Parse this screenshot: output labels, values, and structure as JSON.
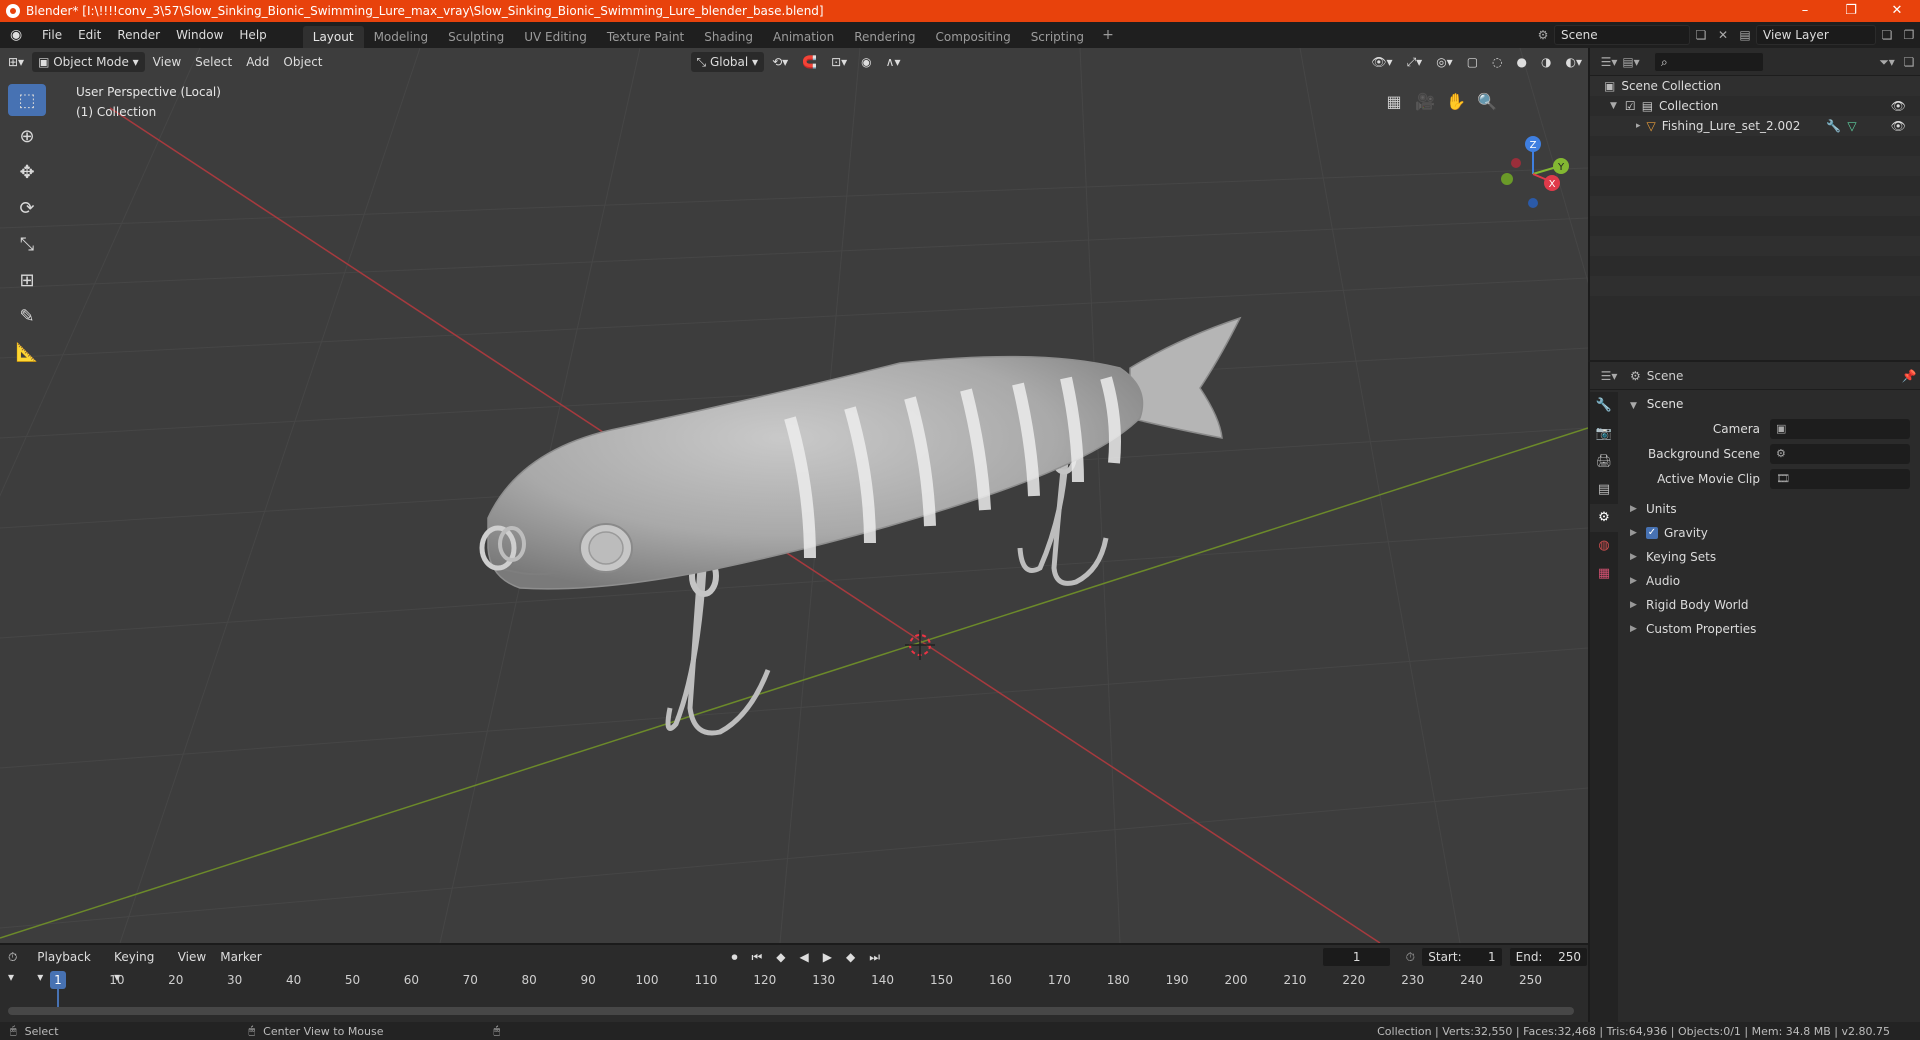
{
  "window": {
    "title": "Blender* [I:\\!!!!conv_3\\57\\Slow_Sinking_Bionic_Swimming_Lure_max_vray\\Slow_Sinking_Bionic_Swimming_Lure_blender_base.blend]",
    "min": "–",
    "max": "❐",
    "close": "✕"
  },
  "menu": [
    "File",
    "Edit",
    "Render",
    "Window",
    "Help"
  ],
  "workspaces": [
    "Layout",
    "Modeling",
    "Sculpting",
    "UV Editing",
    "Texture Paint",
    "Shading",
    "Animation",
    "Rendering",
    "Compositing",
    "Scripting"
  ],
  "workspace_add": "+",
  "scene_field": "Scene",
  "view_layer_field": "View Layer",
  "viewport": {
    "mode": "Object Mode",
    "menus": [
      "View",
      "Select",
      "Add",
      "Object"
    ],
    "orientation": "Global",
    "info_line1": "User Perspective (Local)",
    "info_line2": "(1) Collection",
    "gizmo": {
      "x": "X",
      "y": "Y",
      "z": "Z"
    }
  },
  "outliner": {
    "rows": [
      "Scene Collection",
      "Collection",
      "Fishing_Lure_set_2.002"
    ]
  },
  "properties": {
    "header": "Scene",
    "panel": "Scene",
    "rows": [
      {
        "label": "Camera"
      },
      {
        "label": "Background Scene"
      },
      {
        "label": "Active Movie Clip"
      }
    ],
    "subpanels": [
      "Units",
      "Gravity",
      "Keying Sets",
      "Audio",
      "Rigid Body World",
      "Custom Properties"
    ]
  },
  "timeline": {
    "menus": [
      "Playback",
      "Keying",
      "View",
      "Marker"
    ],
    "current_frame": "1",
    "start_label": "Start:",
    "start": "1",
    "end_label": "End:",
    "end": "250",
    "ticks": [
      "10",
      "20",
      "30",
      "40",
      "50",
      "60",
      "70",
      "80",
      "90",
      "100",
      "110",
      "120",
      "130",
      "140",
      "150",
      "160",
      "170",
      "180",
      "190",
      "200",
      "210",
      "220",
      "230",
      "240",
      "250"
    ],
    "cursor_label": "1"
  },
  "status": {
    "left": "Select",
    "middle": "Center View to Mouse",
    "right": "Collection | Verts:32,550 | Faces:32,468 | Tris:64,936 | Objects:0/1 | Mem: 34.8 MB | v2.80.75"
  }
}
